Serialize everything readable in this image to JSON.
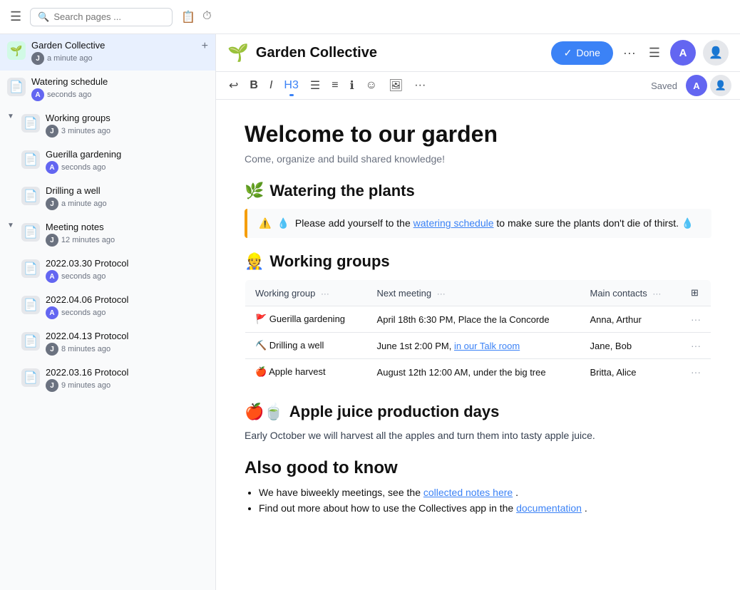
{
  "topbar": {
    "search_placeholder": "Search pages ...",
    "hamburger": "☰"
  },
  "sidebar": {
    "items": [
      {
        "id": "garden-collective",
        "name": "Garden Collective",
        "time": "a minute ago",
        "emoji": "🌱",
        "avatar_color": "#6b7280",
        "avatar_label": "J",
        "is_main": true,
        "indent": 0
      },
      {
        "id": "watering-schedule",
        "name": "Watering schedule",
        "time": "seconds ago",
        "icon": "📄",
        "avatar_color": "#6366f1",
        "avatar_label": "A",
        "indent": 0
      },
      {
        "id": "working-groups",
        "name": "Working groups",
        "time": "3 minutes ago",
        "icon": "📄",
        "avatar_color": "#6b7280",
        "avatar_label": "J",
        "indent": 0,
        "expanded": true
      },
      {
        "id": "guerilla-gardening",
        "name": "Guerilla gardening",
        "time": "seconds ago",
        "icon": "📄",
        "avatar_color": "#6366f1",
        "avatar_label": "A",
        "indent": 1
      },
      {
        "id": "drilling-a-well",
        "name": "Drilling a well",
        "time": "a minute ago",
        "icon": "📄",
        "avatar_color": "#6b7280",
        "avatar_label": "J",
        "indent": 1
      },
      {
        "id": "meeting-notes",
        "name": "Meeting notes",
        "time": "12 minutes ago",
        "icon": "📄",
        "avatar_color": "#6b7280",
        "avatar_label": "J",
        "indent": 0,
        "expanded": true
      },
      {
        "id": "protocol-2022-03-30",
        "name": "2022.03.30 Protocol",
        "time": "seconds ago",
        "icon": "📄",
        "avatar_color": "#6366f1",
        "avatar_label": "A",
        "indent": 1
      },
      {
        "id": "protocol-2022-04-06",
        "name": "2022.04.06 Protocol",
        "time": "seconds ago",
        "icon": "📄",
        "avatar_color": "#6366f1",
        "avatar_label": "A",
        "indent": 1
      },
      {
        "id": "protocol-2022-04-13",
        "name": "2022.04.13 Protocol",
        "time": "8 minutes ago",
        "icon": "📄",
        "avatar_color": "#6b7280",
        "avatar_label": "J",
        "indent": 1
      },
      {
        "id": "protocol-2022-03-16",
        "name": "2022.03.16 Protocol",
        "time": "9 minutes ago",
        "icon": "📄",
        "avatar_color": "#6b7280",
        "avatar_label": "J",
        "indent": 1
      }
    ]
  },
  "header": {
    "emoji": "🌱",
    "title": "Garden Collective",
    "done_label": "Done",
    "saved_label": "Saved"
  },
  "toolbar": {
    "undo": "↩",
    "bold": "B",
    "italic": "I",
    "heading": "H3",
    "bullet": "☰",
    "numbered": "☰",
    "info": "i",
    "emoji": "☺",
    "image": "⬜",
    "more": "···"
  },
  "page": {
    "title": "Welcome to our garden",
    "subtitle": "Come, organize and build shared knowledge!",
    "sections": [
      {
        "id": "watering",
        "emoji": "🌿",
        "heading": "Watering the plants",
        "callout": {
          "icons": "⚠️ 💧",
          "text_before": "Please add yourself to the",
          "link_text": "watering schedule",
          "text_after": "to make sure the plants don't die of thirst.",
          "icon_after": "💧"
        }
      },
      {
        "id": "working-groups",
        "emoji": "👷",
        "heading": "Working groups",
        "table": {
          "columns": [
            "Working group",
            "Next meeting",
            "Main contacts"
          ],
          "rows": [
            {
              "group": "🚩 Guerilla gardening",
              "meeting": "April 18th 6:30 PM, Place the la Concorde",
              "contacts": "Anna, Arthur",
              "link": null
            },
            {
              "group": "⛏️ Drilling a well",
              "meeting": "June 1st 2:00 PM,",
              "meeting_link": "in our Talk room",
              "contacts": "Jane, Bob"
            },
            {
              "group": "🍎 Apple harvest",
              "meeting": "August 12th 12:00 AM, under the big tree",
              "contacts": "Britta, Alice",
              "link": null
            }
          ]
        }
      },
      {
        "id": "apple-juice",
        "emoji": "🍎🍵",
        "heading": "Apple juice production days",
        "para": "Early October we will harvest all the apples and turn them into tasty apple juice."
      },
      {
        "id": "also-know",
        "heading": "Also good to know",
        "bullets": [
          {
            "text": "We have biweekly meetings, see the",
            "link_text": "collected notes here",
            "text_after": "."
          },
          {
            "text": "Find out more about how to use the Collectives app in the",
            "link_text": "documentation",
            "text_after": "."
          }
        ]
      }
    ]
  }
}
